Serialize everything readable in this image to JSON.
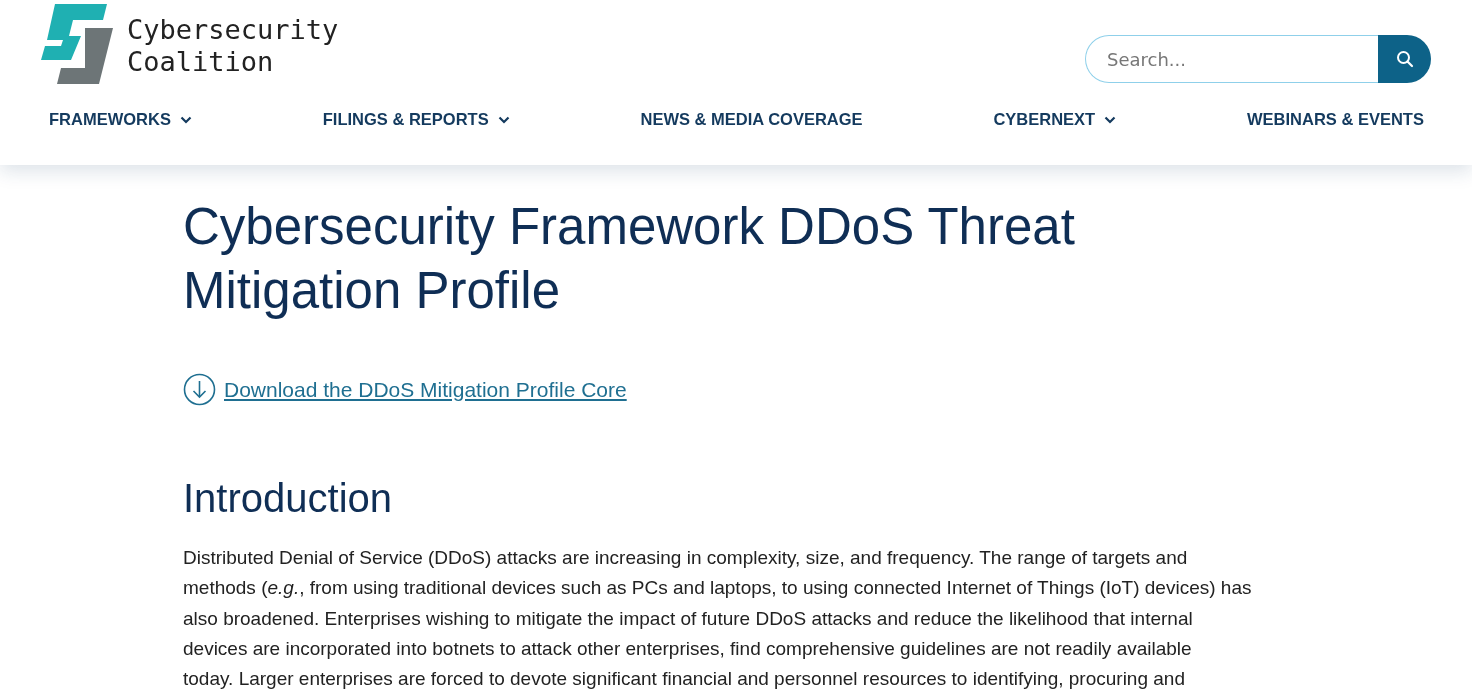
{
  "header": {
    "logo_text": [
      "Cybersecurity",
      "Coalition"
    ],
    "search": {
      "placeholder": "Search..."
    }
  },
  "nav": [
    {
      "label": "FRAMEWORKS",
      "has_dropdown": true
    },
    {
      "label": "FILINGS & REPORTS",
      "has_dropdown": true
    },
    {
      "label": "NEWS & MEDIA COVERAGE",
      "has_dropdown": false
    },
    {
      "label": "CYBERNEXT",
      "has_dropdown": true
    },
    {
      "label": "WEBINARS & EVENTS",
      "has_dropdown": false
    }
  ],
  "title": "Cybersecurity Framework DDoS Threat Mitigation Profile",
  "download_link": "Download the DDoS Mitigation Profile Core",
  "section_heading": "Introduction",
  "paragraph_lines": [
    "Distributed Denial of Service (DDoS) attacks are increasing in complexity, size, and frequency. The range of targets and",
    "methods (*e.g.*, from using traditional devices such as PCs and laptops, to using connected Internet of Things (IoT) devices) has",
    "also broadened. Enterprises wishing to mitigate the impact of future DDoS attacks and reduce the likelihood that internal",
    "devices are incorporated into botnets to attack other enterprises, find comprehensive guidelines are not readily available",
    "today. Larger enterprises are forced to devote significant financial and personnel resources to identifying, procuring and"
  ]
}
